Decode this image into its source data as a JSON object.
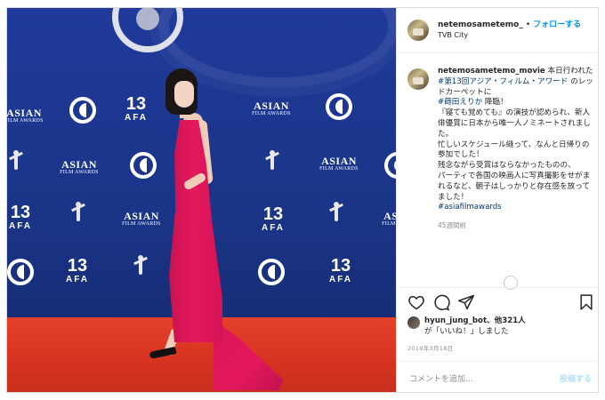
{
  "post": {
    "username": "netemosametemo_",
    "dot": "•",
    "follow_label": "フォローする",
    "location": "TVB City"
  },
  "caption": {
    "username": "netemosametemo_movie",
    "line1": "本日行われた",
    "hashtag1": "#第13回アジア・フィルム・アワード",
    "line2": "のレッドカーペットに",
    "hashtag2": "#蒔田えりか",
    "line3": "降臨！",
    "line4": "『寝ても覚めても』の演技が認められ、新人俳優賞に日本から唯一人ノミネートされました。",
    "line5": "忙しいスケジュール縫って、なんと日帰りの参加でした！",
    "line6": "残念ながら受賞はならなかったものの、",
    "line7": "パーティで各国の映画人に写真撮影をせがまれるなど、朝子はしっかりと存在感を放ってました！",
    "hashtag3": "#asiafilmawards",
    "time": "45週間前"
  },
  "likes": {
    "user": "hyun_jung_bot",
    "others": "、他321人",
    "suffix": "が「いいね！」しました"
  },
  "date": "2019年3月18日",
  "comment": {
    "placeholder": "コメントを追加...",
    "post_label": "投稿する"
  },
  "backdrop": {
    "brand_top": "ASIAN",
    "brand_bottom": "FILM AWARDS",
    "edition_number": "13",
    "edition_letters": "AFA"
  },
  "icons": [
    "heart-icon",
    "comment-icon",
    "share-icon",
    "bookmark-icon"
  ],
  "colors": {
    "accent": "#0095f6",
    "backdrop": "#1f3a9a",
    "carpet": "#d63320",
    "dress": "#e5185e"
  }
}
